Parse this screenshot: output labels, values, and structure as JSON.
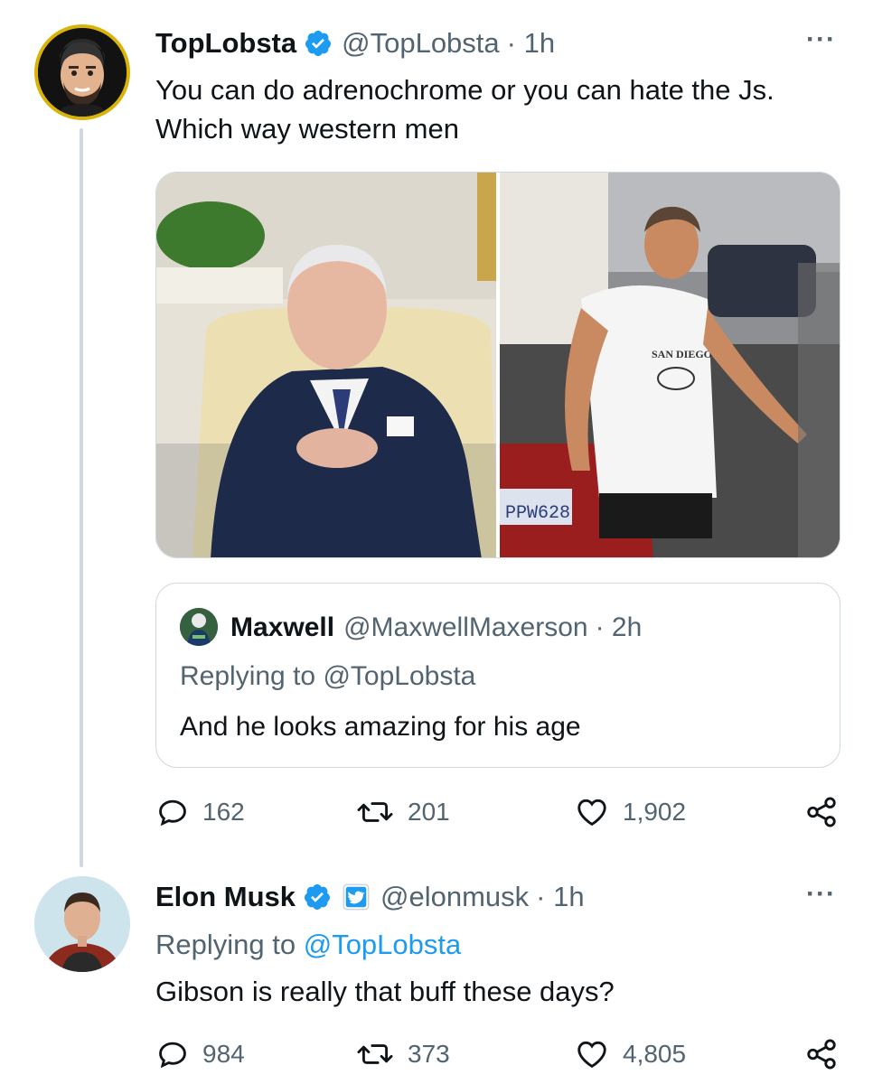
{
  "tweet": {
    "author_name": "TopLobsta",
    "author_handle": "@TopLobsta",
    "time": "· 1h",
    "more": "···",
    "text_line1": "You can do adrenochrome or you can hate the Js.",
    "text_line2": "Which way western men",
    "media": [
      {
        "icon": "photo-man-in-suit-seated"
      },
      {
        "icon": "photo-man-in-tank-top-walking",
        "plate_text": "PPW628",
        "shirt_text": "SAN DIEGO"
      }
    ],
    "quote": {
      "author_name": "Maxwell",
      "author_handle": "@MaxwellMaxerson",
      "time": "· 2h",
      "replying_prefix": "Replying to",
      "replying_handle": "@TopLobsta",
      "text": "And he looks amazing for his age"
    },
    "stats": {
      "replies": "162",
      "retweets": "201",
      "likes": "1,902"
    }
  },
  "reply": {
    "author_name": "Elon Musk",
    "author_handle": "@elonmusk",
    "time": "· 1h",
    "more": "···",
    "replying_prefix": "Replying to",
    "replying_handle": "@TopLobsta",
    "text": "Gibson is really that buff these days?",
    "stats": {
      "replies": "984",
      "retweets": "373",
      "likes": "4,805"
    }
  },
  "colors": {
    "verified": "#1d9bf0",
    "muted": "#536471",
    "link": "#1d9bf0",
    "affiliate_badge": "#1d9bf0"
  }
}
